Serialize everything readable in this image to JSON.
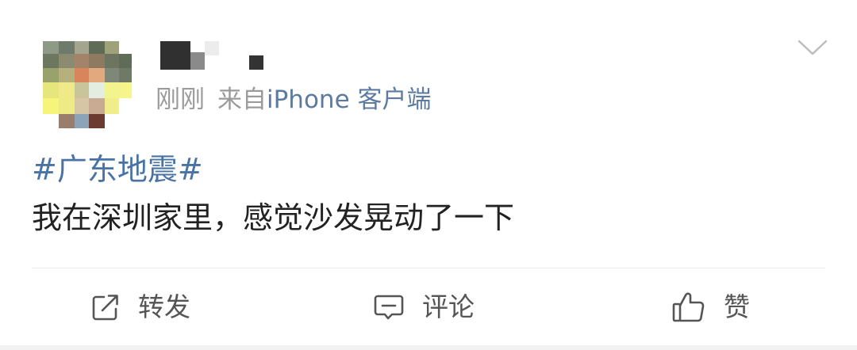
{
  "post": {
    "time": "刚刚",
    "source_prefix": "来自",
    "source_client": "iPhone 客户端",
    "hashtag": "#广东地震#",
    "text": "我在深圳家里，感觉沙发晃动了一下"
  },
  "actions": {
    "repost_label": "转发",
    "comment_label": "评论",
    "like_label": "赞"
  },
  "colors": {
    "link": "#4a73a5",
    "meta_gray": "#9b9b9b",
    "text": "#222222",
    "action_text": "#555555",
    "divider": "#ececec"
  },
  "icons": {
    "more": "chevron-down-icon",
    "repost": "share-icon",
    "comment": "comment-icon",
    "like": "thumbs-up-icon"
  }
}
